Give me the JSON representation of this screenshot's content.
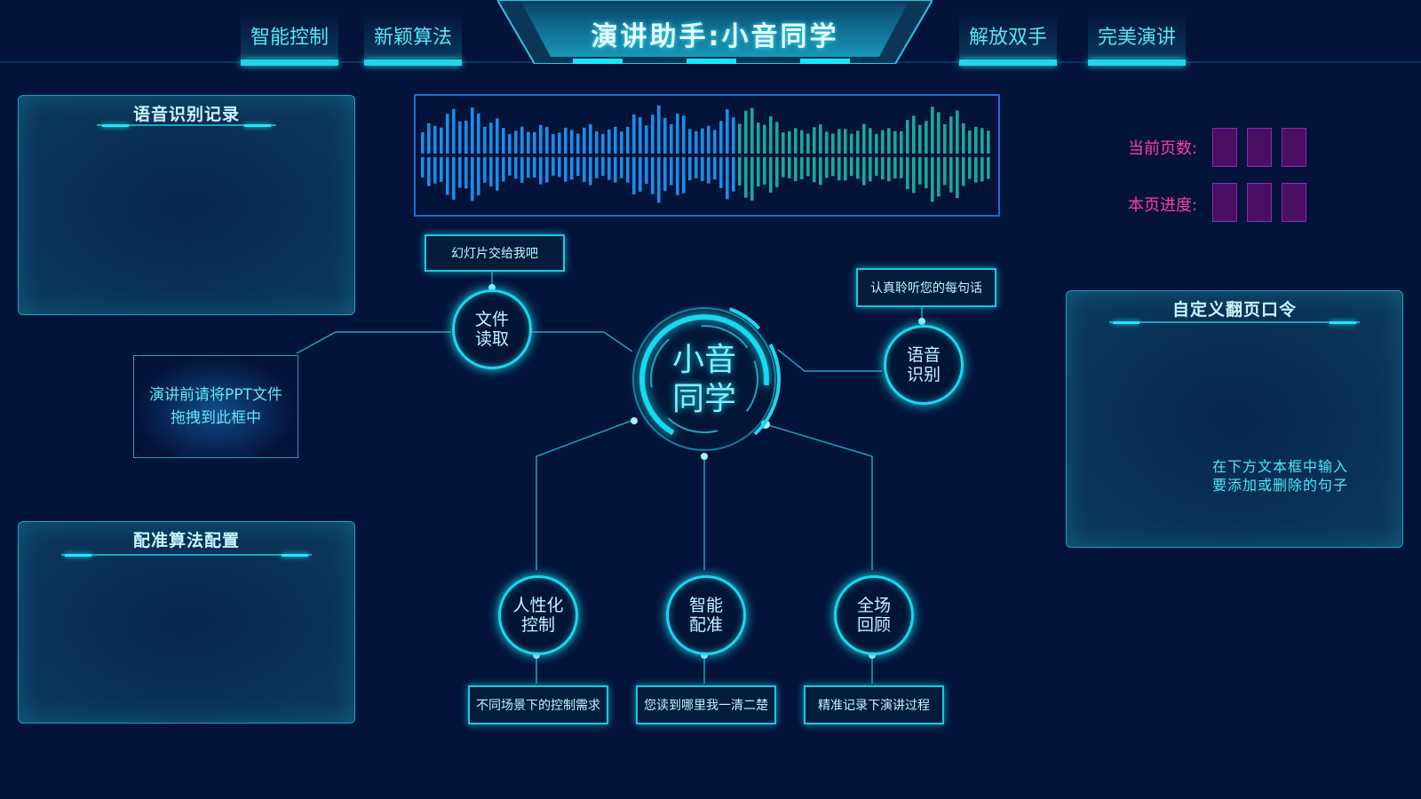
{
  "nav": {
    "tabs_left": [
      "智能控制",
      "新颖算法"
    ],
    "title": "演讲助手:小音同学",
    "tabs_right": [
      "解放双手",
      "完美演讲"
    ]
  },
  "panels": {
    "speech_log_title": "语音识别记录",
    "align_config_title": "配准算法配置",
    "custom_command_title": "自定义翻页口令",
    "custom_command_hint_line1": "在下方文本框中输入",
    "custom_command_hint_line2": "要添加或删除的句子"
  },
  "page_info": {
    "current_page_label": "当前页数:",
    "page_progress_label": "本页进度:"
  },
  "drop_zone": {
    "line1": "演讲前请将PPT文件",
    "line2": "拖拽到此框中"
  },
  "hub": {
    "line1": "小音",
    "line2": "同学"
  },
  "features": {
    "file_read": {
      "line1": "文件",
      "line2": "读取",
      "tag": "幻灯片交给我吧"
    },
    "speech_rec": {
      "line1": "语音",
      "line2": "识别",
      "tag": "认真聆听您的每句话"
    },
    "control": {
      "line1": "人性化",
      "line2": "控制",
      "tag": "不同场景下的控制需求"
    },
    "align": {
      "line1": "智能",
      "line2": "配准",
      "tag": "您读到哪里我一清二楚"
    },
    "review": {
      "line1": "全场",
      "line2": "回顾",
      "tag": "精准记录下演讲过程"
    }
  },
  "colors": {
    "background": "#03133a",
    "accent": "#18d9ef",
    "label_pink": "#ff3da8",
    "box_purple": "#4a0f63",
    "wave_blue": "#1a8de8",
    "wave_teal": "#1aa89a"
  }
}
